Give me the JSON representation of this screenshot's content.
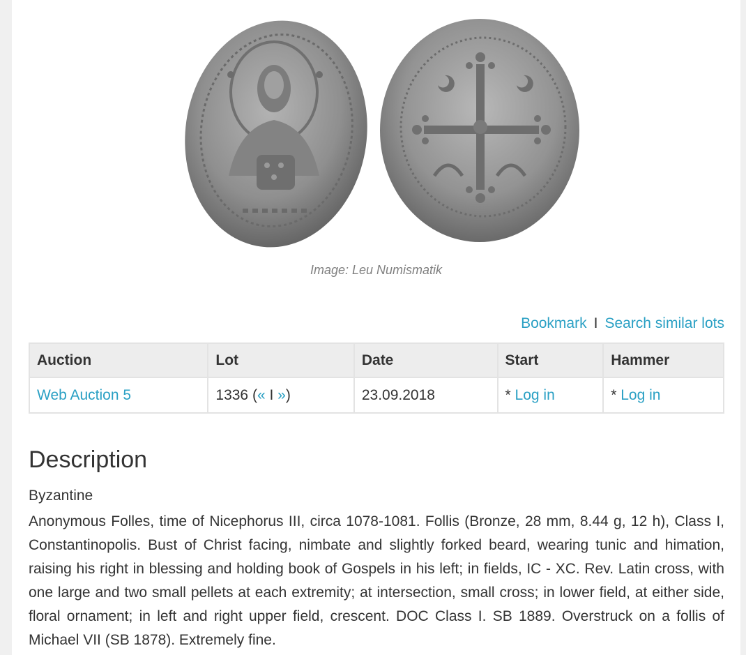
{
  "image": {
    "caption": "Image: Leu Numismatik"
  },
  "actions": {
    "bookmark": "Bookmark",
    "separator": "I",
    "search_similar": "Search similar lots"
  },
  "table": {
    "headers": [
      "Auction",
      "Lot",
      "Date",
      "Start",
      "Hammer"
    ],
    "row": {
      "auction": "Web Auction 5",
      "lot_number": "1336 (",
      "lot_prev": "«",
      "lot_sep": " I ",
      "lot_next": "»",
      "lot_close": ")",
      "date": "23.09.2018",
      "start_prefix": "* ",
      "start_link": "Log in",
      "hammer_prefix": "* ",
      "hammer_link": "Log in"
    }
  },
  "description": {
    "title": "Description",
    "category": "Byzantine",
    "text": "Anonymous Folles, time of Nicephorus III, circa 1078-1081. Follis (Bronze, 28 mm, 8.44 g, 12 h), Class I, Constantinopolis. Bust of Christ facing, nimbate and slightly forked beard, wearing tunic and himation, raising his right in blessing and holding book of Gospels in his left; in fields, IC - XC. Rev. Latin cross, with one large and two small pellets at each extremity; at intersection, small cross; in lower field, at either side, floral ornament; in left and right upper field, crescent. DOC Class I. SB 1889. Overstruck on a follis of Michael VII (SB 1878). Extremely fine."
  },
  "colors": {
    "link": "#2aa0c4",
    "header_bg": "#ededed",
    "text": "#333333"
  }
}
